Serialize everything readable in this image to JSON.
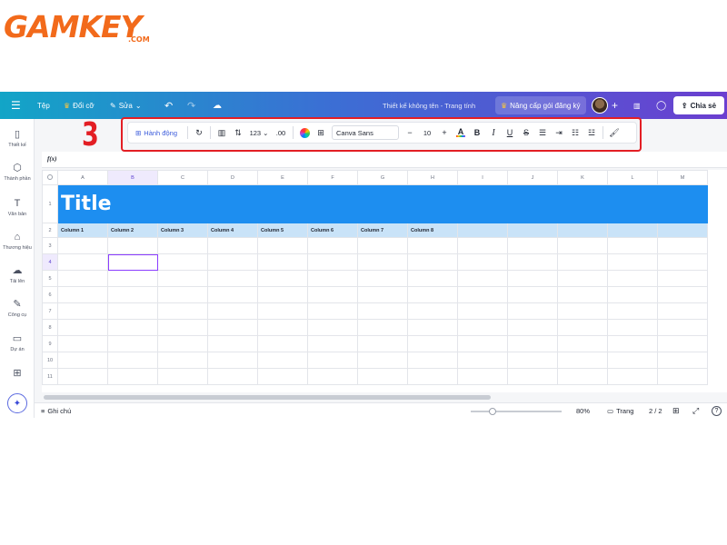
{
  "logo": {
    "text": "GAMKEY",
    "suffix": ".COM"
  },
  "annotation": {
    "step_number": "3"
  },
  "topbar": {
    "menu_icon": "hamburger-icon",
    "file_label": "Tệp",
    "resize_label": "Đổi cỡ",
    "edit_label": "Sửa",
    "document_title": "Thiết kế không tên - Trang tính",
    "upgrade_label": "Nâng cấp gói đăng ký",
    "share_label": "Chia sẻ"
  },
  "sidebar": {
    "items": [
      {
        "label": "Thiết kế",
        "icon": "layout-icon",
        "glyph": "▯"
      },
      {
        "label": "Thành phần",
        "icon": "elements-icon",
        "glyph": "⬡"
      },
      {
        "label": "Văn bản",
        "icon": "text-icon",
        "glyph": "T"
      },
      {
        "label": "Thương hiệu",
        "icon": "brand-icon",
        "glyph": "⌂"
      },
      {
        "label": "Tải lên",
        "icon": "upload-icon",
        "glyph": "☁"
      },
      {
        "label": "Công cụ",
        "icon": "tools-icon",
        "glyph": "✎"
      },
      {
        "label": "Dự án",
        "icon": "folder-icon",
        "glyph": "▭"
      },
      {
        "label": "",
        "icon": "apps-icon",
        "glyph": "⊞"
      }
    ]
  },
  "toolbar": {
    "actions_label": "Hành động",
    "number_format": "123",
    "decimal_label": ".00",
    "font_name": "Canva Sans",
    "font_size": "10",
    "minus": "−",
    "plus": "+",
    "bold": "B",
    "italic": "I",
    "underline": "U",
    "strike": "S",
    "text_color": "A"
  },
  "formula_bar": {
    "label": "f(x)"
  },
  "grid": {
    "columns": [
      "A",
      "B",
      "C",
      "D",
      "E",
      "F",
      "G",
      "H",
      "I",
      "J",
      "K",
      "L",
      "M"
    ],
    "rows": [
      "1",
      "2",
      "3",
      "4",
      "5",
      "6",
      "7",
      "8",
      "9",
      "10",
      "11"
    ],
    "title": "Title",
    "column_headers": [
      "Column 1",
      "Column 2",
      "Column 3",
      "Column 4",
      "Column 5",
      "Column 6",
      "Column 7",
      "Column 8"
    ],
    "selected_column": "B",
    "selected_row": "4"
  },
  "bottombar": {
    "notes_label": "Ghi chú",
    "zoom": "80%",
    "pages_label": "Trang",
    "page_count": "2 / 2",
    "help": "?"
  },
  "colors": {
    "accent": "#8b3dff",
    "title_fill": "#1d8ef0",
    "header_fill": "#c9e3f8",
    "highlight": "#e31e24",
    "logo": "#f26a1b"
  }
}
